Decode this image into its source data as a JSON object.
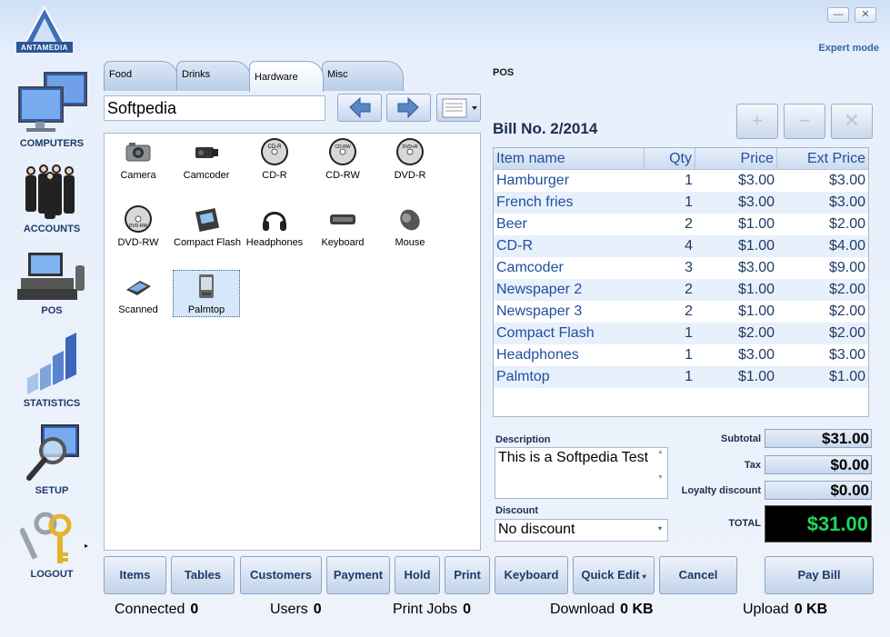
{
  "header": {
    "logo_text": "ANTAMEDIA",
    "expert_mode": "Expert mode",
    "minimize": "—",
    "close": "✕"
  },
  "nav": [
    {
      "label": "COMPUTERS"
    },
    {
      "label": "ACCOUNTS"
    },
    {
      "label": "POS"
    },
    {
      "label": "STATISTICS"
    },
    {
      "label": "SETUP"
    },
    {
      "label": "LOGOUT"
    }
  ],
  "tabs": [
    "Food",
    "Drinks",
    "Hardware",
    "Misc"
  ],
  "active_tab": "Hardware",
  "search_value": "Softpedia",
  "products": [
    {
      "label": "Camera",
      "icon": "camera-icon"
    },
    {
      "label": "Camcoder",
      "icon": "camcorder-icon"
    },
    {
      "label": "CD-R",
      "icon": "cd-icon",
      "disc_text": "CD-R"
    },
    {
      "label": "CD-RW",
      "icon": "cd-icon",
      "disc_text": "CD-RW"
    },
    {
      "label": "DVD-R",
      "icon": "dvd-icon",
      "disc_text": "DVD+R"
    },
    {
      "label": "DVD-RW",
      "icon": "dvd-icon",
      "disc_text": "DVD-RW"
    },
    {
      "label": "Compact Flash",
      "icon": "compact-flash-icon"
    },
    {
      "label": "Headphones",
      "icon": "headphones-icon"
    },
    {
      "label": "Keyboard",
      "icon": "keyboard-icon"
    },
    {
      "label": "Mouse",
      "icon": "mouse-icon"
    },
    {
      "label": "Scanned",
      "icon": "scanner-icon"
    },
    {
      "label": "Palmtop",
      "icon": "palmtop-icon"
    }
  ],
  "pos": {
    "title": "POS",
    "bill_no": "Bill No. 2/2014",
    "buttons": [
      "+",
      "−",
      "✕"
    ]
  },
  "bill": {
    "headers": [
      "Item name",
      "Qty",
      "Price",
      "Ext Price"
    ],
    "rows": [
      [
        "Hamburger",
        "1",
        "$3.00",
        "$3.00"
      ],
      [
        "French fries",
        "1",
        "$3.00",
        "$3.00"
      ],
      [
        "Beer",
        "2",
        "$1.00",
        "$2.00"
      ],
      [
        "CD-R",
        "4",
        "$1.00",
        "$4.00"
      ],
      [
        "Camcoder",
        "3",
        "$3.00",
        "$9.00"
      ],
      [
        "Newspaper 2",
        "2",
        "$1.00",
        "$2.00"
      ],
      [
        "Newspaper 3",
        "2",
        "$1.00",
        "$2.00"
      ],
      [
        "Compact Flash",
        "1",
        "$2.00",
        "$2.00"
      ],
      [
        "Headphones",
        "1",
        "$3.00",
        "$3.00"
      ],
      [
        "Palmtop",
        "1",
        "$1.00",
        "$1.00"
      ]
    ]
  },
  "description": {
    "label": "Description",
    "value": "This is a Softpedia Test"
  },
  "discount": {
    "label": "Discount",
    "value": "No discount"
  },
  "totals": {
    "subtotal_label": "Subtotal",
    "subtotal": "$31.00",
    "tax_label": "Tax",
    "tax": "$0.00",
    "loyalty_label": "Loyalty discount",
    "loyalty": "$0.00",
    "total_label": "TOTAL",
    "total": "$31.00"
  },
  "actions": {
    "items": "Items",
    "tables": "Tables",
    "customers": "Customers",
    "payment": "Payment",
    "hold": "Hold",
    "print": "Print",
    "keyboard": "Keyboard",
    "quick_edit": "Quick Edit",
    "cancel": "Cancel",
    "pay_bill": "Pay Bill"
  },
  "status": {
    "connected_label": "Connected",
    "connected": "0",
    "users_label": "Users",
    "users": "0",
    "print_jobs_label": "Print Jobs",
    "print_jobs": "0",
    "download_label": "Download",
    "download": "0 KB",
    "upload_label": "Upload",
    "upload": "0 KB"
  },
  "colors": {
    "accent": "#1f4fa0",
    "total_green": "#1fd65b"
  }
}
